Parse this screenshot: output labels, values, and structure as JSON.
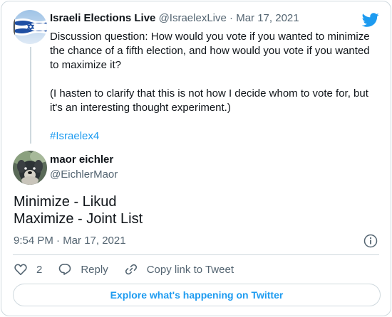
{
  "quoted": {
    "author_name": "Israeli Elections Live",
    "handle": "@IsraelexLive",
    "separator": "·",
    "date": "Mar 17, 2021",
    "paragraph1": "Discussion question: How would you vote if you wanted to minimize the chance of a fifth election, and how would you vote if you wanted to maximize it?",
    "paragraph2": "(I hasten to clarify that this is not how I decide whom to vote for, but it's an interesting thought experiment.)",
    "hashtag": "#Israelex4",
    "avatar_icon": "israeli-flag-avatar"
  },
  "reply": {
    "author_name": "maor eichler",
    "handle": "@EichlerMaor",
    "line1": "Minimize - Likud",
    "line2": "Maximize - Joint List",
    "time": "9:54 PM · Mar 17, 2021",
    "avatar_icon": "dog-photo-avatar"
  },
  "actions": {
    "like_count": "2",
    "reply_label": "Reply",
    "copy_link_label": "Copy link to Tweet"
  },
  "footer": {
    "explore_label": "Explore what's happening on Twitter"
  },
  "colors": {
    "accent": "#1d9bf0",
    "text": "#0f1419",
    "muted": "#536471",
    "border": "#cfd9de"
  }
}
